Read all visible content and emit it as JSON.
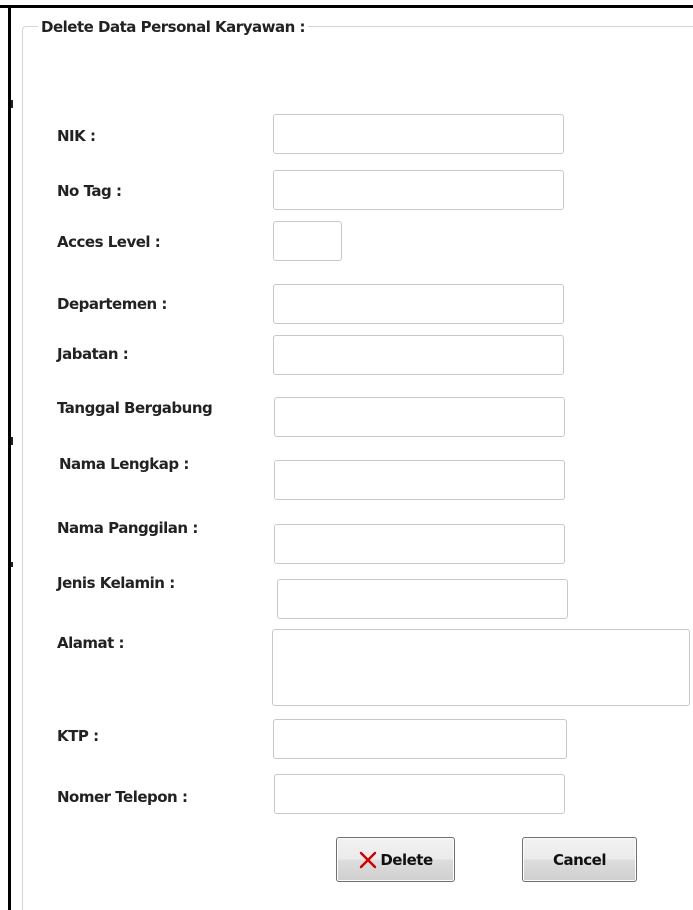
{
  "groupbox": {
    "title": "Delete Data Personal Karyawan :"
  },
  "form": {
    "fields": [
      {
        "label": "NIK :",
        "value": ""
      },
      {
        "label": "No Tag :",
        "value": ""
      },
      {
        "label": "Acces Level :",
        "value": ""
      },
      {
        "label": "Departemen :",
        "value": ""
      },
      {
        "label": "Jabatan :",
        "value": ""
      },
      {
        "label": "Tanggal Bergabung",
        "value": ""
      },
      {
        "label": "Nama Lengkap :",
        "value": ""
      },
      {
        "label": "Nama Panggilan :",
        "value": ""
      },
      {
        "label": "Jenis Kelamin :",
        "value": ""
      },
      {
        "label": "Alamat :",
        "value": ""
      },
      {
        "label": "KTP :",
        "value": ""
      },
      {
        "label": "Nomer Telepon :",
        "value": ""
      }
    ]
  },
  "buttons": {
    "delete_label": "Delete",
    "delete_icon": "close-x-icon",
    "delete_icon_color": "#cc0000",
    "cancel_label": "Cancel"
  }
}
